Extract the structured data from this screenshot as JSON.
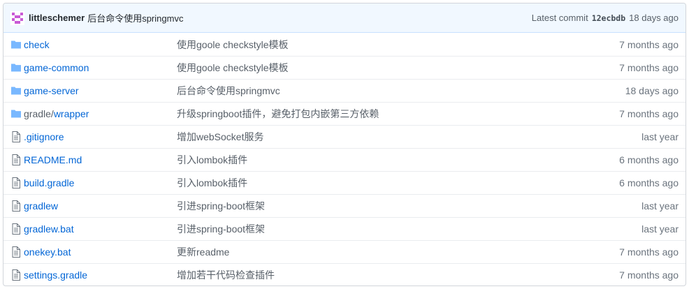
{
  "commit": {
    "author": "littleschemer",
    "message": "后台命令使用springmvc",
    "latest_label": "Latest commit",
    "sha": "12ecbdb",
    "age": "18 days ago"
  },
  "files": [
    {
      "type": "folder",
      "prefix": "",
      "name": "check",
      "message": "使用goole checkstyle模板",
      "age": "7 months ago"
    },
    {
      "type": "folder",
      "prefix": "",
      "name": "game-common",
      "message": "使用goole checkstyle模板",
      "age": "7 months ago"
    },
    {
      "type": "folder",
      "prefix": "",
      "name": "game-server",
      "message": "后台命令使用springmvc",
      "age": "18 days ago"
    },
    {
      "type": "folder",
      "prefix": "gradle/",
      "name": "wrapper",
      "message": "升级springboot插件，避免打包内嵌第三方依赖",
      "age": "7 months ago"
    },
    {
      "type": "file",
      "prefix": "",
      "name": ".gitignore",
      "message": "增加webSocket服务",
      "age": "last year"
    },
    {
      "type": "file",
      "prefix": "",
      "name": "README.md",
      "message": "引入lombok插件",
      "age": "6 months ago"
    },
    {
      "type": "file",
      "prefix": "",
      "name": "build.gradle",
      "message": "引入lombok插件",
      "age": "6 months ago"
    },
    {
      "type": "file",
      "prefix": "",
      "name": "gradlew",
      "message": "引进spring-boot框架",
      "age": "last year"
    },
    {
      "type": "file",
      "prefix": "",
      "name": "gradlew.bat",
      "message": "引进spring-boot框架",
      "age": "last year"
    },
    {
      "type": "file",
      "prefix": "",
      "name": "onekey.bat",
      "message": "更新readme",
      "age": "7 months ago"
    },
    {
      "type": "file",
      "prefix": "",
      "name": "settings.gradle",
      "message": "增加若干代码检查插件",
      "age": "7 months ago"
    }
  ],
  "colors": {
    "folder": "#79b8ff",
    "file_icon": "#6a737d",
    "link": "#0366d6",
    "avatar": "#c95ad6"
  }
}
